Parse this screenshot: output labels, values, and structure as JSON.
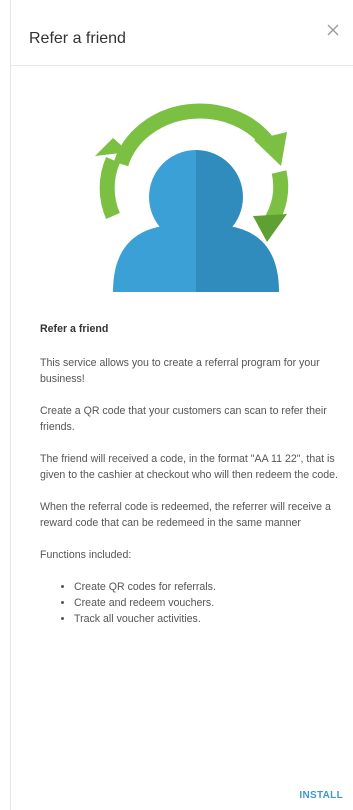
{
  "dialog": {
    "title": "Refer a friend",
    "close_icon": "close-icon"
  },
  "hero": {
    "icon": "user-refresh-icon",
    "colors": {
      "arrow_green": "#7bc043",
      "user_blue": "#3aa0d5",
      "user_blue_dark": "#2f8cbd"
    }
  },
  "content": {
    "heading": "Refer a friend",
    "paragraphs": [
      "This service allows you to create a referral program for your business!",
      "Create a QR code that your customers can scan to refer their friends.",
      "The friend will received a code, in the format \"AA 11 22\", that is given to the cashier at checkout who will then redeem the code.",
      "When the referral code is redeemed, the referrer will receive a reward code that can be redemeed in the same manner",
      "Functions included:"
    ],
    "functions": [
      "Create QR codes for referrals.",
      "Create and redeem vouchers.",
      "Track all voucher activities."
    ]
  },
  "footer": {
    "install_label": "INSTALL",
    "accent_color": "#3f97d6"
  }
}
